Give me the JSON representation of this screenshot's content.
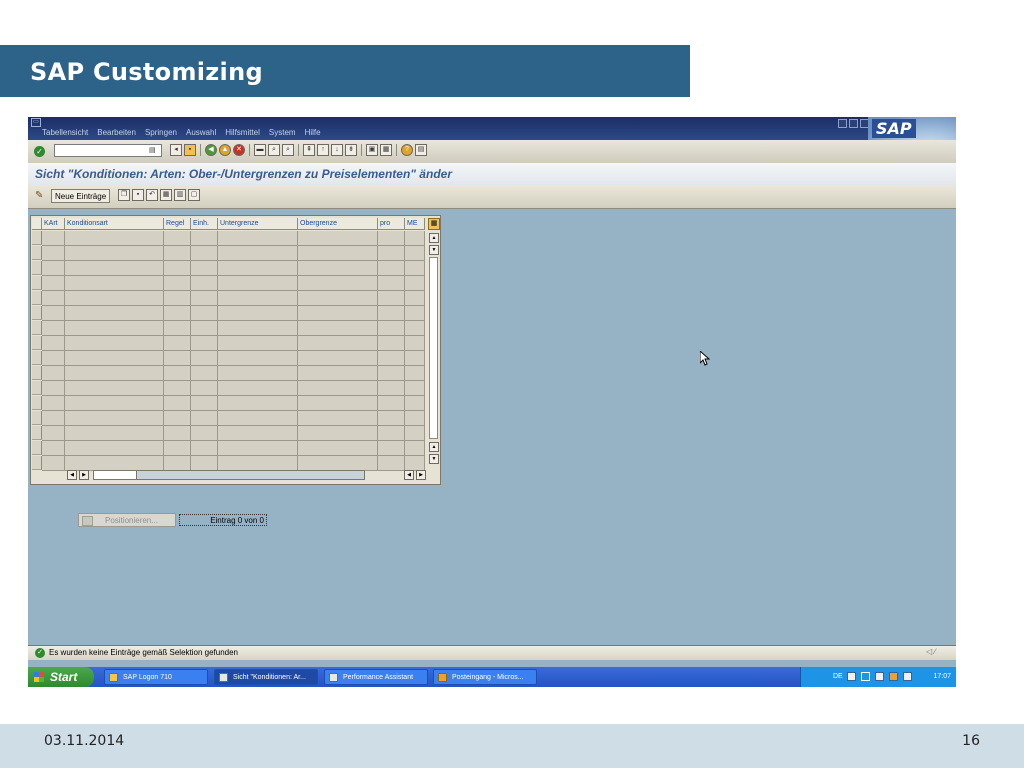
{
  "slide": {
    "title": "SAP Customizing",
    "date": "03.11.2014",
    "page_number": "16"
  },
  "sap": {
    "menu": [
      "Tabellensicht",
      "Bearbeiten",
      "Springen",
      "Auswahl",
      "Hilfsmittel",
      "System",
      "Hilfe"
    ],
    "logo_text": "SAP",
    "command_field_value": "",
    "screen_title": "Sicht \"Konditionen: Arten: Ober-/Untergrenzen zu Preiselementen\" änder",
    "toolbar2": {
      "new_entries_label": "Neue Einträge"
    },
    "table": {
      "columns": [
        "KArt",
        "Konditionsart",
        "Regel",
        "Einh.",
        "Untergrenze",
        "Obergrenze",
        "pro",
        "ME"
      ],
      "visible_empty_rows": 16
    },
    "position_button_label": "Positionieren...",
    "entry_count_text": "Eintrag 0 von 0",
    "status_message": "Es wurden keine Einträge gemäß Selektion gefunden"
  },
  "taskbar": {
    "start_label": "Start",
    "tasks": [
      {
        "label": "SAP Logon 710",
        "active": false
      },
      {
        "label": "Sicht \"Konditionen: Ar...",
        "active": true
      },
      {
        "label": "Performance Assistant",
        "active": false
      },
      {
        "label": "Posteingang - Micros...",
        "active": false
      }
    ],
    "language": "DE",
    "clock": "17:07"
  },
  "colors": {
    "slide_title_bg": "#2d6389",
    "sap_background": "#96b3c6",
    "menubar_bg": "#1c2d66",
    "screen_title_color": "#3a5c8c",
    "taskbar_bg": "#2454c5",
    "start_button_bg": "#2e8a2e"
  }
}
